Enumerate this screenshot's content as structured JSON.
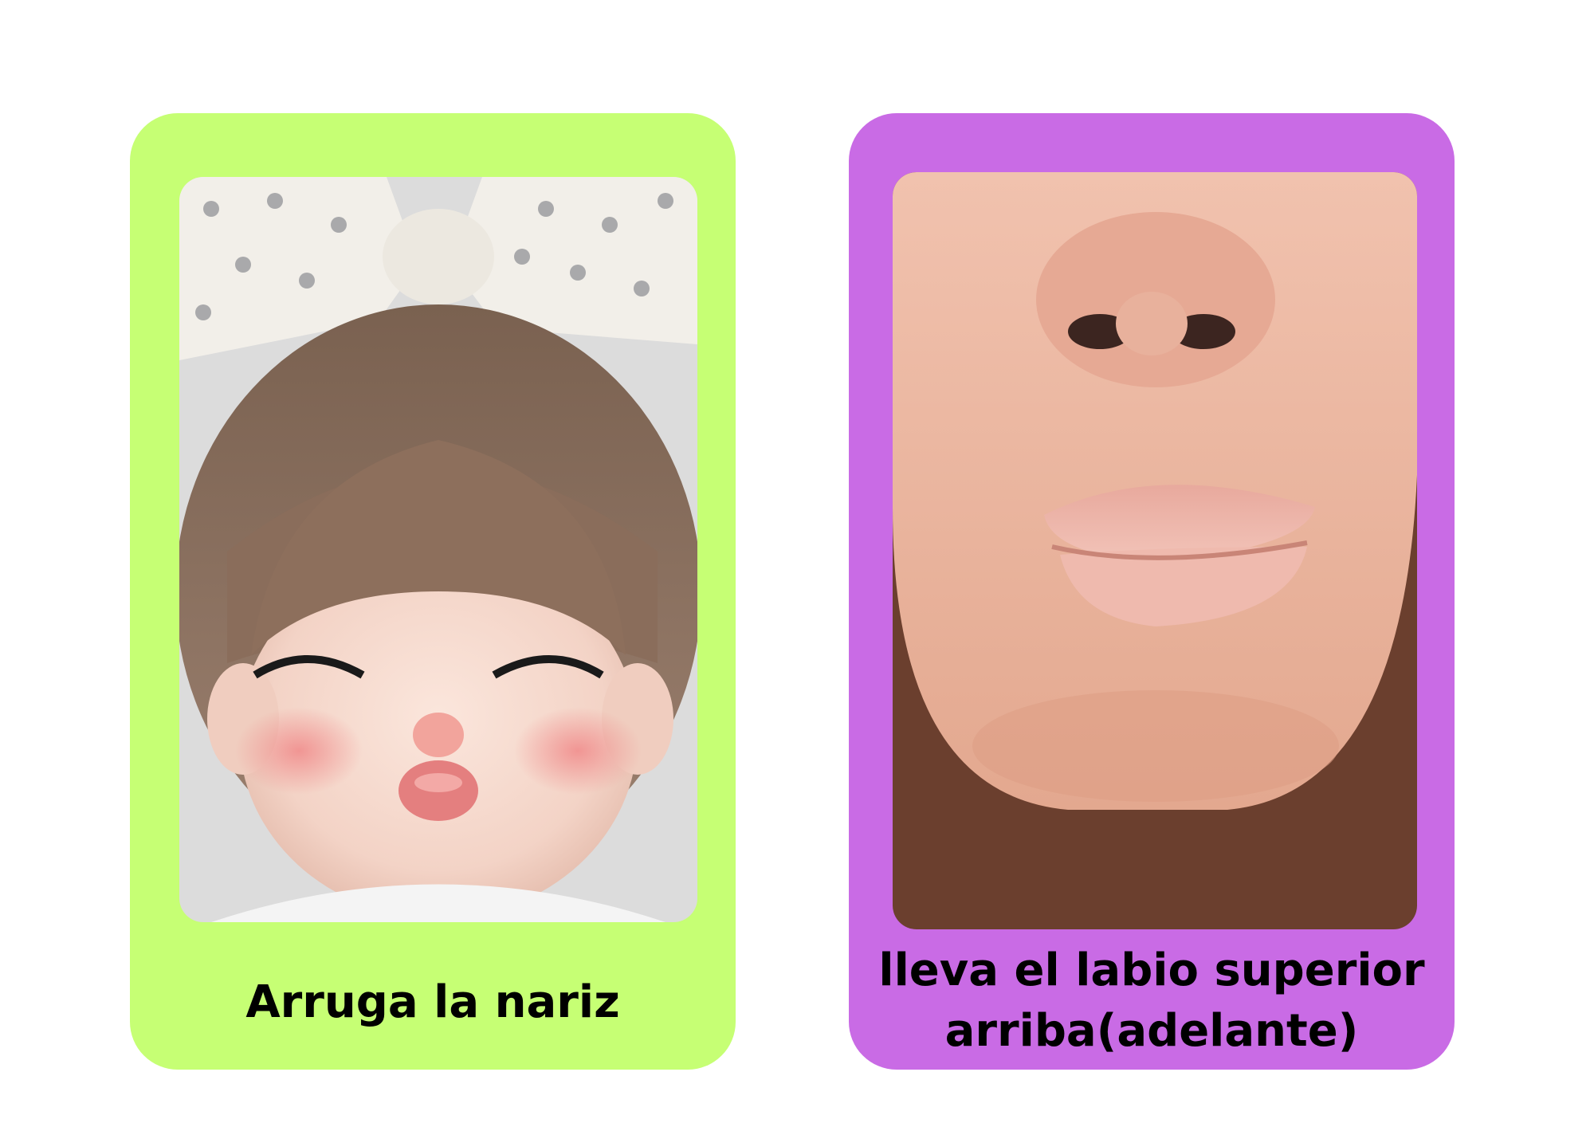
{
  "cards": [
    {
      "caption": "Arruga la nariz",
      "image": "child-scrunching-nose-photo",
      "background": "#c6ff74"
    },
    {
      "caption_line1": "lleva el labio superior",
      "caption_line2": "arriba(adelante)",
      "image": "pursed-lips-photo",
      "background": "#c96be5"
    }
  ]
}
